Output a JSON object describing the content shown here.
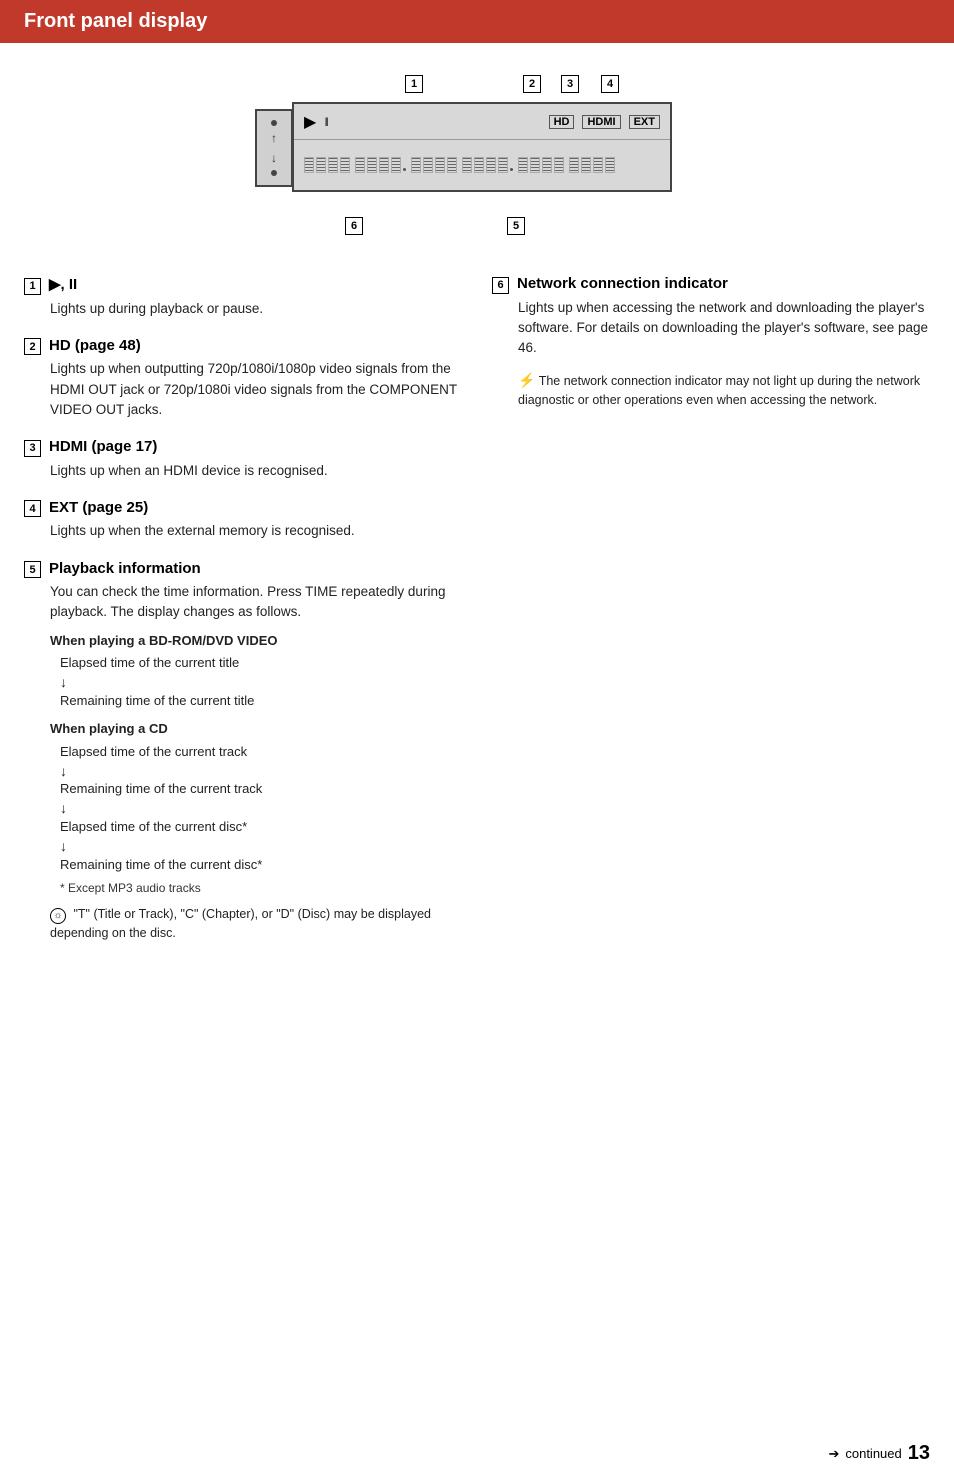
{
  "page": {
    "title": "Front panel display",
    "page_number": "13",
    "continued_text": "continued"
  },
  "diagram": {
    "callouts": [
      "1",
      "2",
      "3",
      "4",
      "5",
      "6"
    ],
    "badges": {
      "hd": "HD",
      "hdmi": "HDMI",
      "ext": "EXT"
    }
  },
  "sections": [
    {
      "num": "1",
      "title": "▶, II",
      "body": "Lights up during playback or pause."
    },
    {
      "num": "2",
      "title": "HD (page 48)",
      "body": "Lights up when outputting 720p/1080i/1080p video signals from the HDMI OUT jack or 720p/1080i video signals from the COMPONENT VIDEO OUT jacks."
    },
    {
      "num": "3",
      "title": "HDMI (page 17)",
      "body": "Lights up when an HDMI device is recognised."
    },
    {
      "num": "4",
      "title": "EXT (page 25)",
      "body": "Lights up when the external memory is recognised."
    },
    {
      "num": "5",
      "title": "Playback information",
      "body": "You can check the time information. Press TIME repeatedly during playback. The display changes as follows.",
      "subsections": [
        {
          "title": "When playing a BD-ROM/DVD VIDEO",
          "items": [
            "Elapsed time of the current title",
            "↓",
            "Remaining time of the current title"
          ]
        },
        {
          "title": "When playing a CD",
          "items": [
            "Elapsed time of the current track",
            "↓",
            "Remaining time of the current track",
            "↓",
            "Elapsed time of the current disc*",
            "↓",
            "Remaining time of the current disc*"
          ],
          "footnote": "* Except MP3 audio tracks"
        }
      ],
      "tip": {
        "symbol": "☼",
        "text": "\"T\" (Title or Track), \"C\" (Chapter), or \"D\" (Disc) may be displayed depending on the disc."
      }
    },
    {
      "num": "6",
      "title": "Network connection indicator",
      "body": "Lights up when accessing the network and downloading the player's software. For details on downloading the player's software, see page 46.",
      "warning": {
        "symbol": "⚡",
        "text": "The network connection indicator may not light up during the network diagnostic or other operations even when accessing the network."
      }
    }
  ]
}
